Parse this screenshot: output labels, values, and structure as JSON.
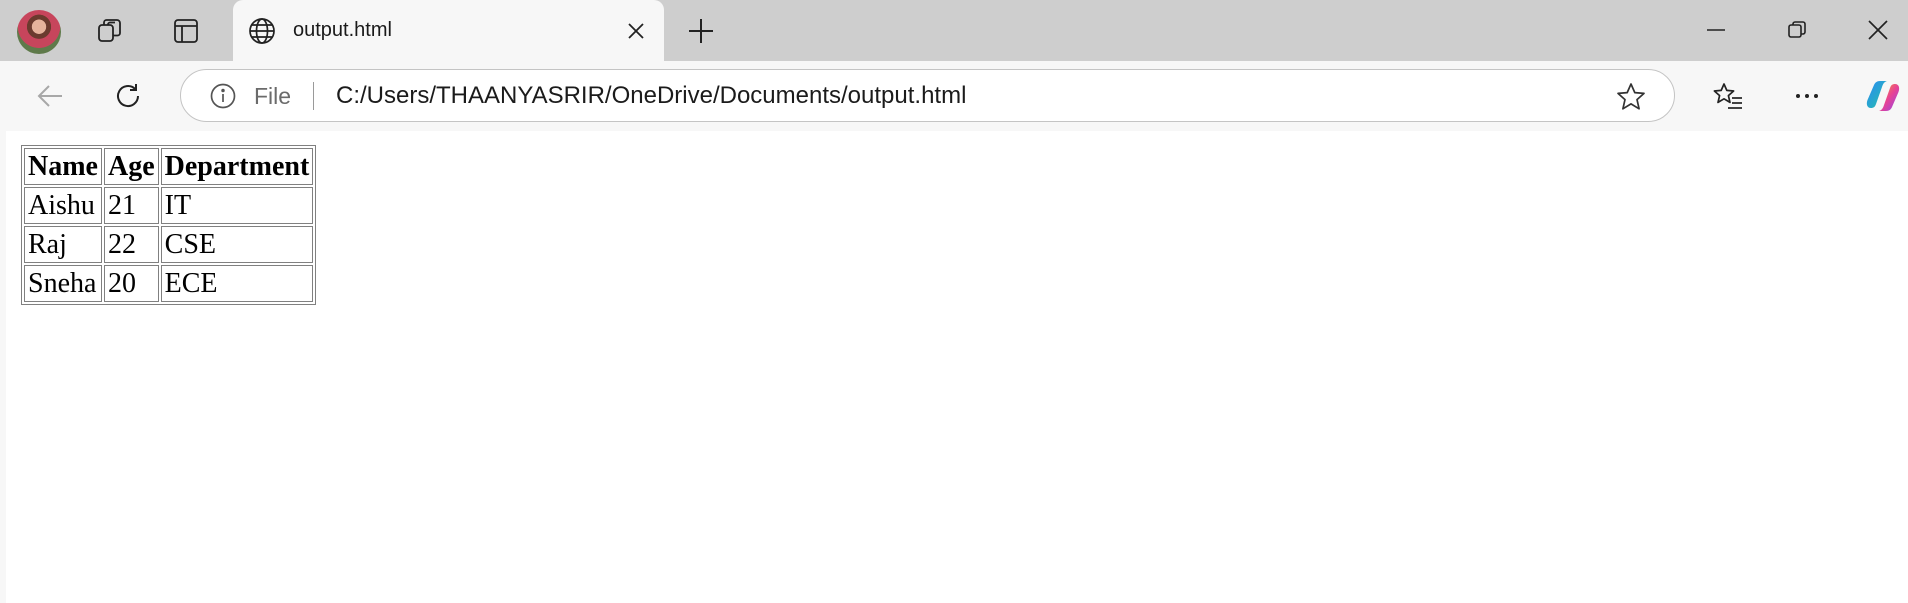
{
  "tab": {
    "title": "output.html"
  },
  "address_bar": {
    "scheme_label": "File",
    "url": "C:/Users/THAANYASRIR/OneDrive/Documents/output.html"
  },
  "table": {
    "headers": [
      "Name",
      "Age",
      "Department"
    ],
    "rows": [
      [
        "Aishu",
        "21",
        "IT"
      ],
      [
        "Raj",
        "22",
        "CSE"
      ],
      [
        "Sneha",
        "20",
        "ECE"
      ]
    ]
  },
  "icons": {
    "profile": "avatar",
    "workspaces": "workspaces-icon",
    "tab_actions": "tab-actions-icon",
    "site": "globe-icon",
    "close_tab": "close-icon",
    "new_tab": "plus-icon",
    "minimize": "minimize-icon",
    "restore": "restore-icon",
    "close_window": "close-icon",
    "back": "back-arrow-icon",
    "refresh": "refresh-icon",
    "site_info": "info-icon",
    "favorite": "star-icon",
    "favorites": "favorites-icon",
    "more": "more-icon",
    "copilot": "copilot-icon"
  }
}
